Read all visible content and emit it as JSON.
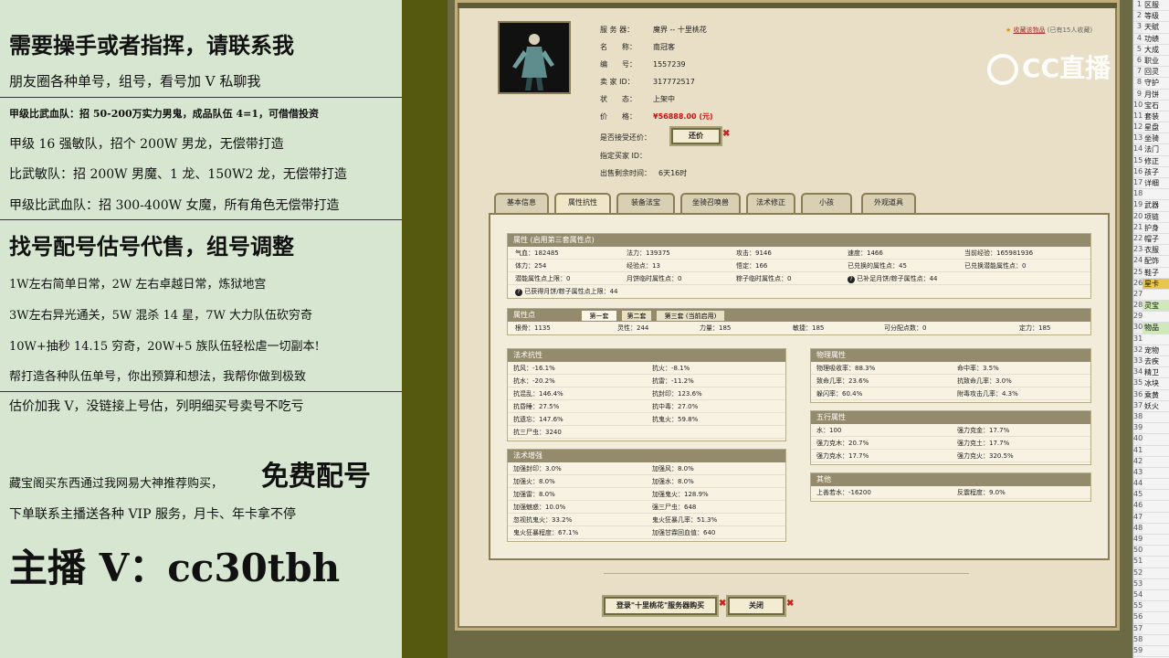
{
  "ad": {
    "line1": "需要操手或者指挥，请联系我",
    "line2": "朋友圈各种单号，组号，看号加 V 私聊我",
    "line3": "甲级比武血队：招 50-200万实力男鬼，成品队伍 4=1，可借借投资",
    "line4": "甲级 16 强敏队，招个 200W 男龙，无偿带打造",
    "line5": "比武敏队：招 200W 男魔、1 龙、150W2 龙，无偿带打造",
    "line6": "甲级比武血队：招 300-400W 女魔，所有角色无偿带打造",
    "line7": "找号配号估号代售，组号调整",
    "line8": "1W左右简单日常，2W 左右卓越日常，炼狱地宫",
    "line9": "3W左右异光通关，5W 混杀 14 星，7W 大力队伍砍穷奇",
    "line10": "10W+抽秒 14.15 穷奇，20W+5 族队伍轻松虐一切副本!",
    "line11": "帮打造各种队伍单号，你出预算和想法，我帮你做到极致",
    "line12": "估价加我 V，没链接上号估，列明细买号卖号不吃亏",
    "line13a": "藏宝阁买东西通过我网易大神推荐购买，",
    "line13b": "免费配号",
    "line14": "下单联系主播送各种 VIP 服务，月卡、年卡拿不停",
    "line15": "主播 V：cc30tbh"
  },
  "watermark": "CC直播",
  "fav": "收藏该物品",
  "fav_count": "(已有15人收藏)",
  "info": [
    {
      "k": "服 务 器：",
      "v": "魔界 -- 十里桃花"
    },
    {
      "k": "名　　称：",
      "v": "南冠客"
    },
    {
      "k": "编　　号：",
      "v": "1557239"
    },
    {
      "k": "卖 家 ID：",
      "v": "317772517"
    },
    {
      "k": "状　　态：",
      "v": "上架中"
    },
    {
      "k": "价　　格：",
      "v": "¥56888.00 (元)"
    }
  ],
  "bargain_label": "是否接受还价：",
  "bargain_btn": "还价",
  "buyer_label": "指定买家 ID：",
  "time_label": "出售剩余时间：",
  "time_value": "6天16时",
  "tabs": [
    "基本信息",
    "属性抗性",
    "装备法宝",
    "坐骑召唤兽",
    "法术修正",
    "小孩",
    "外观道具"
  ],
  "attr": {
    "title": "属性 (启用第三套属性点)",
    "r1": [
      "气血：182485",
      "法力：139375",
      "攻击：9146",
      "速度：1466",
      "当前经验：165981936"
    ],
    "r2": [
      "体力：254",
      "经验点：13",
      "悟定：166",
      "已兑换的属性点：45",
      "已兑换潜能属性点：0"
    ],
    "r3": [
      "潜能属性点上限：0",
      "月饼临时属性点：0",
      "粽子临时属性点：0",
      "已补足月饼/粽子属性点：44"
    ],
    "r4": "已获得月饼/粽子属性点上限：44"
  },
  "points": {
    "title": "属性点",
    "tabs": [
      "第一套",
      "第二套",
      "第三套 (当前启用)"
    ],
    "row": [
      "根骨：1135",
      "灵性：244",
      "力量：185",
      "敏捷：185",
      "可分配点数：0",
      "定力：185"
    ]
  },
  "resist": {
    "title": "法术抗性",
    "rows": [
      [
        "抗风：-16.1%",
        "抗火：-8.1%"
      ],
      [
        "抗水：-20.2%",
        "抗雷：-11.2%"
      ],
      [
        "抗混乱：146.4%",
        "抗封印：123.6%"
      ],
      [
        "抗昏睡：27.5%",
        "抗中毒：27.0%"
      ],
      [
        "抗遗忘：147.6%",
        "抗鬼火：59.8%"
      ],
      [
        "抗三尸虫：3240",
        ""
      ]
    ]
  },
  "enhance": {
    "title": "法术增强",
    "rows": [
      [
        "加强封印：3.0%",
        "加强风：8.0%"
      ],
      [
        "加强火：8.0%",
        "加强水：8.0%"
      ],
      [
        "加强雷：8.0%",
        "加强鬼火：128.9%"
      ],
      [
        "加强魅惑：10.0%",
        "强三尸虫：648"
      ],
      [
        "忽视抗鬼火：33.2%",
        "鬼火狂暴几率：51.3%"
      ],
      [
        "鬼火狂暴程度：67.1%",
        "加强甘霖回血值：640"
      ]
    ]
  },
  "physical": {
    "title": "物理属性",
    "rows": [
      [
        "物理吸收率：88.3%",
        "命中率：3.5%"
      ],
      [
        "致命几率：23.6%",
        "抗致命几率：3.0%"
      ],
      [
        "躲闪率：60.4%",
        "附毒攻击几率：4.3%"
      ]
    ]
  },
  "wuxing": {
    "title": "五行属性",
    "rows": [
      [
        "水：100",
        "强力克金：17.7%"
      ],
      [
        "强力克木：20.7%",
        "强力克土：17.7%"
      ],
      [
        "强力克水：17.7%",
        "强力克火：320.5%"
      ]
    ]
  },
  "other": {
    "title": "其他",
    "rows": [
      [
        "上善若水：-16200",
        "反震程度：9.0%"
      ]
    ]
  },
  "login_btn": "登录\"十里桃花\"服务器购买",
  "close_btn": "关闭",
  "sheet": [
    [
      "1",
      "区服"
    ],
    [
      "2",
      "等级"
    ],
    [
      "3",
      "天赋"
    ],
    [
      "4",
      "功绩"
    ],
    [
      "5",
      "大成"
    ],
    [
      "6",
      "职业"
    ],
    [
      "7",
      "回灵"
    ],
    [
      "8",
      "守护"
    ],
    [
      "9",
      "月饼"
    ],
    [
      "10",
      "宝石"
    ],
    [
      "11",
      "套装"
    ],
    [
      "12",
      "星盘"
    ],
    [
      "13",
      "坐骑"
    ],
    [
      "14",
      "法门"
    ],
    [
      "15",
      "修正"
    ],
    [
      "16",
      "孩子"
    ],
    [
      "17",
      "详细"
    ],
    [
      "18",
      ""
    ],
    [
      "19",
      "武器"
    ],
    [
      "20",
      "项链"
    ],
    [
      "21",
      "护身"
    ],
    [
      "22",
      "帽子"
    ],
    [
      "23",
      "衣服"
    ],
    [
      "24",
      "配饰"
    ],
    [
      "25",
      "鞋子"
    ],
    [
      "26",
      "星卡"
    ],
    [
      "27",
      ""
    ],
    [
      "28",
      "灵宝"
    ],
    [
      "29",
      ""
    ],
    [
      "30",
      "物品"
    ],
    [
      "31",
      ""
    ],
    [
      "32",
      "宠物"
    ],
    [
      "33",
      "去疾"
    ],
    [
      "34",
      "精卫"
    ],
    [
      "35",
      "冰块"
    ],
    [
      "36",
      "乘黄"
    ],
    [
      "37",
      "妖火"
    ],
    [
      "38",
      ""
    ],
    [
      "39",
      ""
    ],
    [
      "40",
      ""
    ],
    [
      "41",
      ""
    ],
    [
      "42",
      ""
    ],
    [
      "43",
      ""
    ],
    [
      "44",
      ""
    ],
    [
      "45",
      ""
    ],
    [
      "46",
      ""
    ],
    [
      "47",
      ""
    ],
    [
      "48",
      ""
    ],
    [
      "49",
      ""
    ],
    [
      "50",
      ""
    ],
    [
      "51",
      ""
    ],
    [
      "52",
      ""
    ],
    [
      "53",
      ""
    ],
    [
      "54",
      ""
    ],
    [
      "55",
      ""
    ],
    [
      "56",
      ""
    ],
    [
      "57",
      ""
    ],
    [
      "58",
      ""
    ],
    [
      "59",
      ""
    ]
  ]
}
